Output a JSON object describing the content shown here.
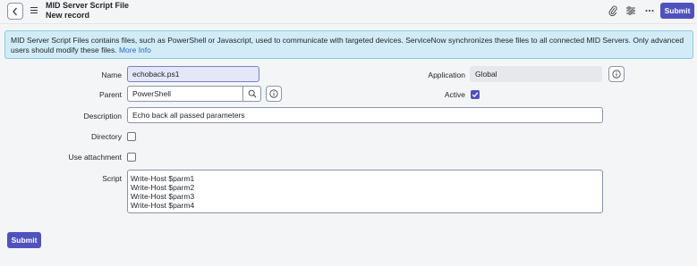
{
  "header": {
    "title": "MID Server Script File",
    "subtitle": "New record",
    "submit_label": "Submit",
    "icons": [
      "chevron-left-icon",
      "hamburger-icon",
      "paperclip-icon",
      "settings-sliders-icon",
      "more-icon"
    ]
  },
  "banner": {
    "text": "MID Server Script Files contains files, such as PowerShell or Javascript, used to communicate with targeted devices. ServiceNow synchronizes these files to all connected MID Servers. Only advanced users should modify these files.",
    "link": "More Info"
  },
  "form": {
    "name": {
      "label": "Name",
      "value": "echoback.ps1"
    },
    "application": {
      "label": "Application",
      "value": "Global"
    },
    "parent": {
      "label": "Parent",
      "value": "PowerShell"
    },
    "active": {
      "label": "Active",
      "checked": true
    },
    "description": {
      "label": "Description",
      "value": "Echo back all passed parameters"
    },
    "directory": {
      "label": "Directory",
      "checked": false
    },
    "use_attachment": {
      "label": "Use attachment",
      "checked": false
    },
    "script": {
      "label": "Script",
      "lines": [
        "Write-Host $parm1",
        "Write-Host $parm2",
        "Write-Host $parm3",
        "Write-Host $parm4"
      ]
    }
  },
  "footer": {
    "submit_label": "Submit"
  },
  "colors": {
    "accent": "#4f52bd",
    "banner_bg": "#d1ecf7",
    "banner_border": "#8fc8e0",
    "link": "#2e66c9"
  }
}
